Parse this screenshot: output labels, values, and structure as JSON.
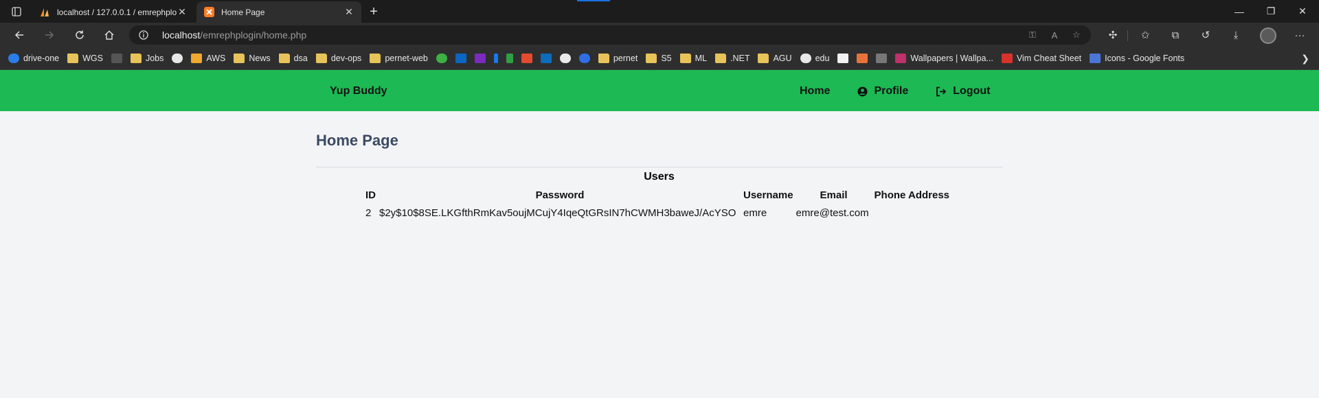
{
  "browser": {
    "tabs": [
      {
        "title": "localhost / 127.0.0.1 / emrephplo",
        "favicon": "phpmyadmin-sail-icon",
        "active": false
      },
      {
        "title": "Home Page",
        "favicon": "xampp-icon",
        "active": true
      }
    ],
    "address": {
      "host": "localhost",
      "path": "/emrephplogin/home.php"
    },
    "bookmarks": [
      {
        "label": "drive-one",
        "icon": "cloud-icon"
      },
      {
        "label": "WGS",
        "icon": "folder-icon"
      },
      {
        "label": "",
        "icon": "site-icon"
      },
      {
        "label": "Jobs",
        "icon": "folder-icon"
      },
      {
        "label": "",
        "icon": "github-icon"
      },
      {
        "label": "AWS",
        "icon": "box-icon"
      },
      {
        "label": "News",
        "icon": "folder-icon"
      },
      {
        "label": "dsa",
        "icon": "folder-icon"
      },
      {
        "label": "dev-ops",
        "icon": "folder-icon"
      },
      {
        "label": "pernet-web",
        "icon": "folder-icon"
      },
      {
        "label": "",
        "icon": "leaf-icon"
      },
      {
        "label": "",
        "icon": "linkedin-icon"
      },
      {
        "label": "",
        "icon": "k-icon"
      },
      {
        "label": "",
        "icon": "facebook-icon"
      },
      {
        "label": "",
        "icon": "phone-icon"
      },
      {
        "label": "",
        "icon": "trello-icon"
      },
      {
        "label": "",
        "icon": "outlook-icon"
      },
      {
        "label": "",
        "icon": "circle-icon"
      },
      {
        "label": "",
        "icon": "c-icon"
      },
      {
        "label": "pernet",
        "icon": "folder-icon"
      },
      {
        "label": "S5",
        "icon": "folder-icon"
      },
      {
        "label": "ML",
        "icon": "folder-icon"
      },
      {
        "label": ".NET",
        "icon": "folder-icon"
      },
      {
        "label": "AGU",
        "icon": "folder-icon"
      },
      {
        "label": "edu",
        "icon": "github-icon"
      },
      {
        "label": "",
        "icon": "code-icon"
      },
      {
        "label": "",
        "icon": "bars-icon"
      },
      {
        "label": "",
        "icon": "r-icon"
      },
      {
        "label": "Wallpapers | Wallpa...",
        "icon": "wallpaper-icon"
      },
      {
        "label": "Vim Cheat Sheet",
        "icon": "vim-icon"
      },
      {
        "label": "Icons - Google Fonts",
        "icon": "fonts-icon"
      }
    ]
  },
  "navbar": {
    "brand": "Yup Buddy",
    "links": [
      {
        "label": "Home",
        "icon": ""
      },
      {
        "label": "Profile",
        "icon": "user-circle-icon"
      },
      {
        "label": "Logout",
        "icon": "sign-out-icon"
      }
    ]
  },
  "page": {
    "title": "Home Page",
    "table": {
      "caption": "Users",
      "headers": [
        "ID",
        "Password",
        "Username",
        "Email",
        "Phone Address"
      ],
      "rows": [
        [
          "2",
          "$2y$10$8SE.LKGfthRmKav5oujMCujY4IqeQtGRsIN7hCWMH3baweJ/AcYSO",
          "emre",
          "emre@test.com",
          ""
        ]
      ]
    }
  },
  "colors": {
    "navbar": "#1db954",
    "page_bg": "#f3f4f6",
    "title": "#3b4a63"
  }
}
